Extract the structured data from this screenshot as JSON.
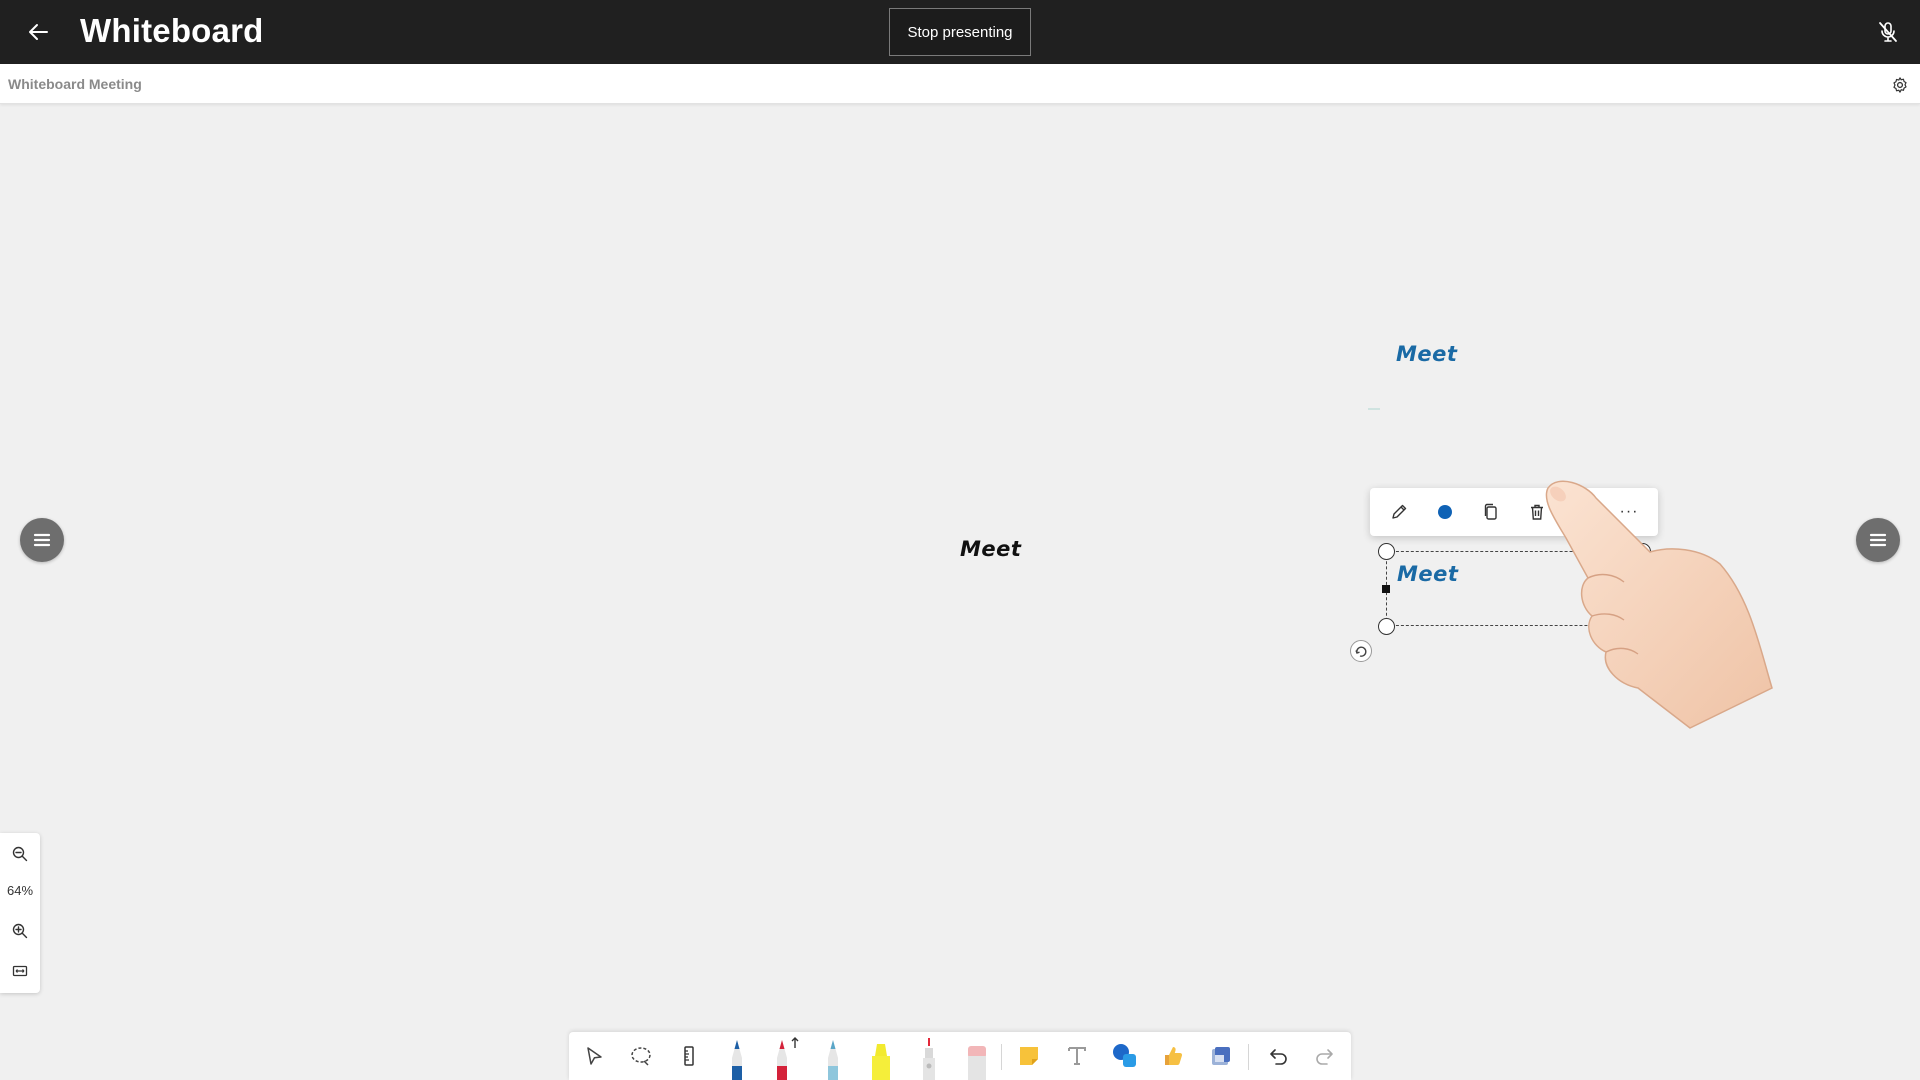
{
  "header": {
    "title": "Whiteboard",
    "stop_presenting_label": "Stop presenting"
  },
  "subheader": {
    "meeting_name": "Whiteboard Meeting"
  },
  "canvas": {
    "texts": [
      {
        "id": "meet-center",
        "text": "Meet",
        "color": "#111111"
      },
      {
        "id": "meet-top",
        "text": "Meet",
        "color": "#1a6aa5"
      },
      {
        "id": "meet-selected",
        "text": "Meet",
        "color": "#1a6aa5"
      }
    ]
  },
  "context_toolbar": {
    "items": [
      "edit-icon",
      "color-icon",
      "copy-icon",
      "delete-icon",
      "duplicate-icon",
      "more-icon"
    ],
    "color": "#0f62b5",
    "more_label": "···"
  },
  "zoom": {
    "level": "64%"
  },
  "tools": {
    "items": [
      "select",
      "lasso",
      "ruler",
      "blue-pen",
      "red-pen",
      "light-blue-pen",
      "highlighter",
      "laser-pointer",
      "eraser",
      "sticky-note",
      "text",
      "shapes",
      "reactions",
      "templates",
      "undo",
      "redo"
    ]
  },
  "colors": {
    "topbar": "#202020",
    "canvas": "#f0f0f0",
    "accent_blue": "#1a6aa5"
  }
}
